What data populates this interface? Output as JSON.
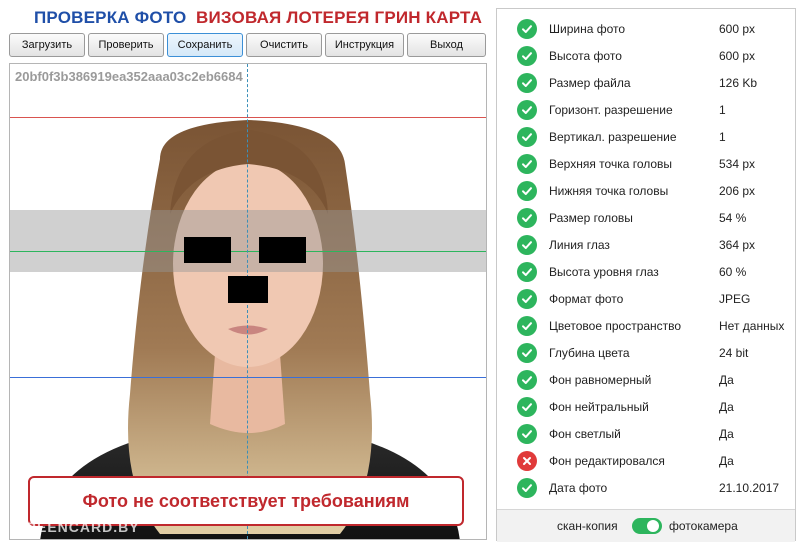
{
  "header": {
    "title_left": "ПРОВЕРКА ФОТО",
    "title_right": "ВИЗОВАЯ ЛОТЕРЕЯ ГРИН КАРТА"
  },
  "toolbar": {
    "buttons": [
      {
        "label": "Загрузить"
      },
      {
        "label": "Проверить"
      },
      {
        "label": "Сохранить",
        "active": true
      },
      {
        "label": "Очистить"
      },
      {
        "label": "Инструкция"
      },
      {
        "label": "Выход"
      }
    ]
  },
  "photo": {
    "hash": "20bf0f3b386919ea352aaa03c2eb6684",
    "watermark": "GREENCARD.BY",
    "verdict": "Фото не соответствует требованиям",
    "guide_colors": {
      "top": "#d9534f",
      "eyes": "#2db55d",
      "bottom": "#3a6fd8",
      "center": "#3a8fb8"
    }
  },
  "checks": [
    {
      "label": "Ширина фото",
      "value": "600 px",
      "status": "ok"
    },
    {
      "label": "Высота фото",
      "value": "600 px",
      "status": "ok"
    },
    {
      "label": "Размер файла",
      "value": "126 Kb",
      "status": "ok"
    },
    {
      "label": "Горизонт. разрешение",
      "value": "1",
      "status": "ok"
    },
    {
      "label": "Вертикал. разрешение",
      "value": "1",
      "status": "ok"
    },
    {
      "label": "Верхняя точка головы",
      "value": "534 px",
      "status": "ok"
    },
    {
      "label": "Нижняя точка головы",
      "value": "206 px",
      "status": "ok"
    },
    {
      "label": "Размер головы",
      "value": "54 %",
      "status": "ok"
    },
    {
      "label": "Линия глаз",
      "value": "364 px",
      "status": "ok"
    },
    {
      "label": "Высота уровня глаз",
      "value": "60 %",
      "status": "ok"
    },
    {
      "label": "Формат фото",
      "value": "JPEG",
      "status": "ok"
    },
    {
      "label": "Цветовое пространство",
      "value": "Нет данных",
      "status": "ok"
    },
    {
      "label": "Глубина цвета",
      "value": "24 bit",
      "status": "ok"
    },
    {
      "label": "Фон равномерный",
      "value": "Да",
      "status": "ok"
    },
    {
      "label": "Фон нейтральный",
      "value": "Да",
      "status": "ok"
    },
    {
      "label": "Фон светлый",
      "value": "Да",
      "status": "ok"
    },
    {
      "label": "Фон редактировался",
      "value": "Да",
      "status": "fail"
    },
    {
      "label": "Дата фото",
      "value": "21.10.2017",
      "status": "ok"
    }
  ],
  "footer": {
    "left_label": "скан-копия",
    "right_label": "фотокамера",
    "toggle_on": true
  },
  "colors": {
    "brand_blue": "#1f4fa8",
    "brand_red": "#c0282d",
    "ok_green": "#2db55d",
    "fail_red": "#e03a3a"
  }
}
